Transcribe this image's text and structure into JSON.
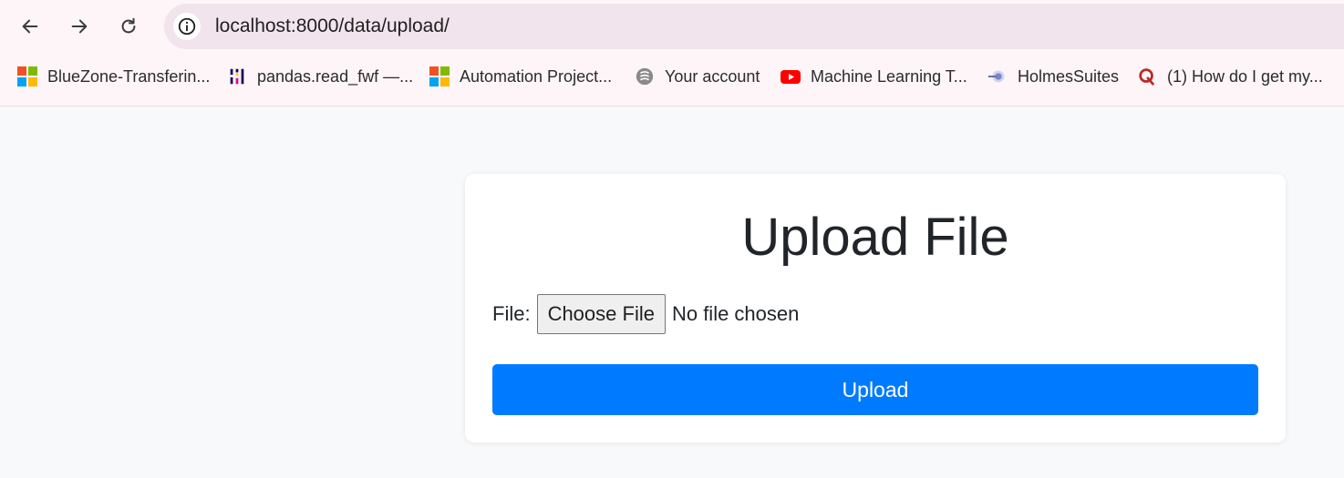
{
  "browser": {
    "url": "localhost:8000/data/upload/",
    "nav": {
      "back_icon": "arrow-left-icon",
      "forward_icon": "arrow-right-icon",
      "reload_icon": "reload-icon",
      "info_icon": "info-icon"
    },
    "bookmarks": [
      {
        "label": "BlueZone-Transferin...",
        "icon": "microsoft-icon"
      },
      {
        "label": "pandas.read_fwf —...",
        "icon": "pandas-icon"
      },
      {
        "label": "Automation Project...",
        "icon": "microsoft-icon"
      },
      {
        "label": "Your account",
        "icon": "account-icon"
      },
      {
        "label": "Machine Learning T...",
        "icon": "youtube-icon"
      },
      {
        "label": "HolmesSuites",
        "icon": "holmes-icon"
      },
      {
        "label": "(1) How do I get my...",
        "icon": "quora-icon"
      }
    ]
  },
  "page": {
    "title": "Upload File",
    "file_label": "File:",
    "choose_file_label": "Choose File",
    "no_file_text": "No file chosen",
    "upload_label": "Upload"
  },
  "colors": {
    "primary": "#007bff",
    "page_bg": "#f8f9fa",
    "chrome_bg": "#fdf5f8",
    "address_bg": "#f1e4ec"
  }
}
